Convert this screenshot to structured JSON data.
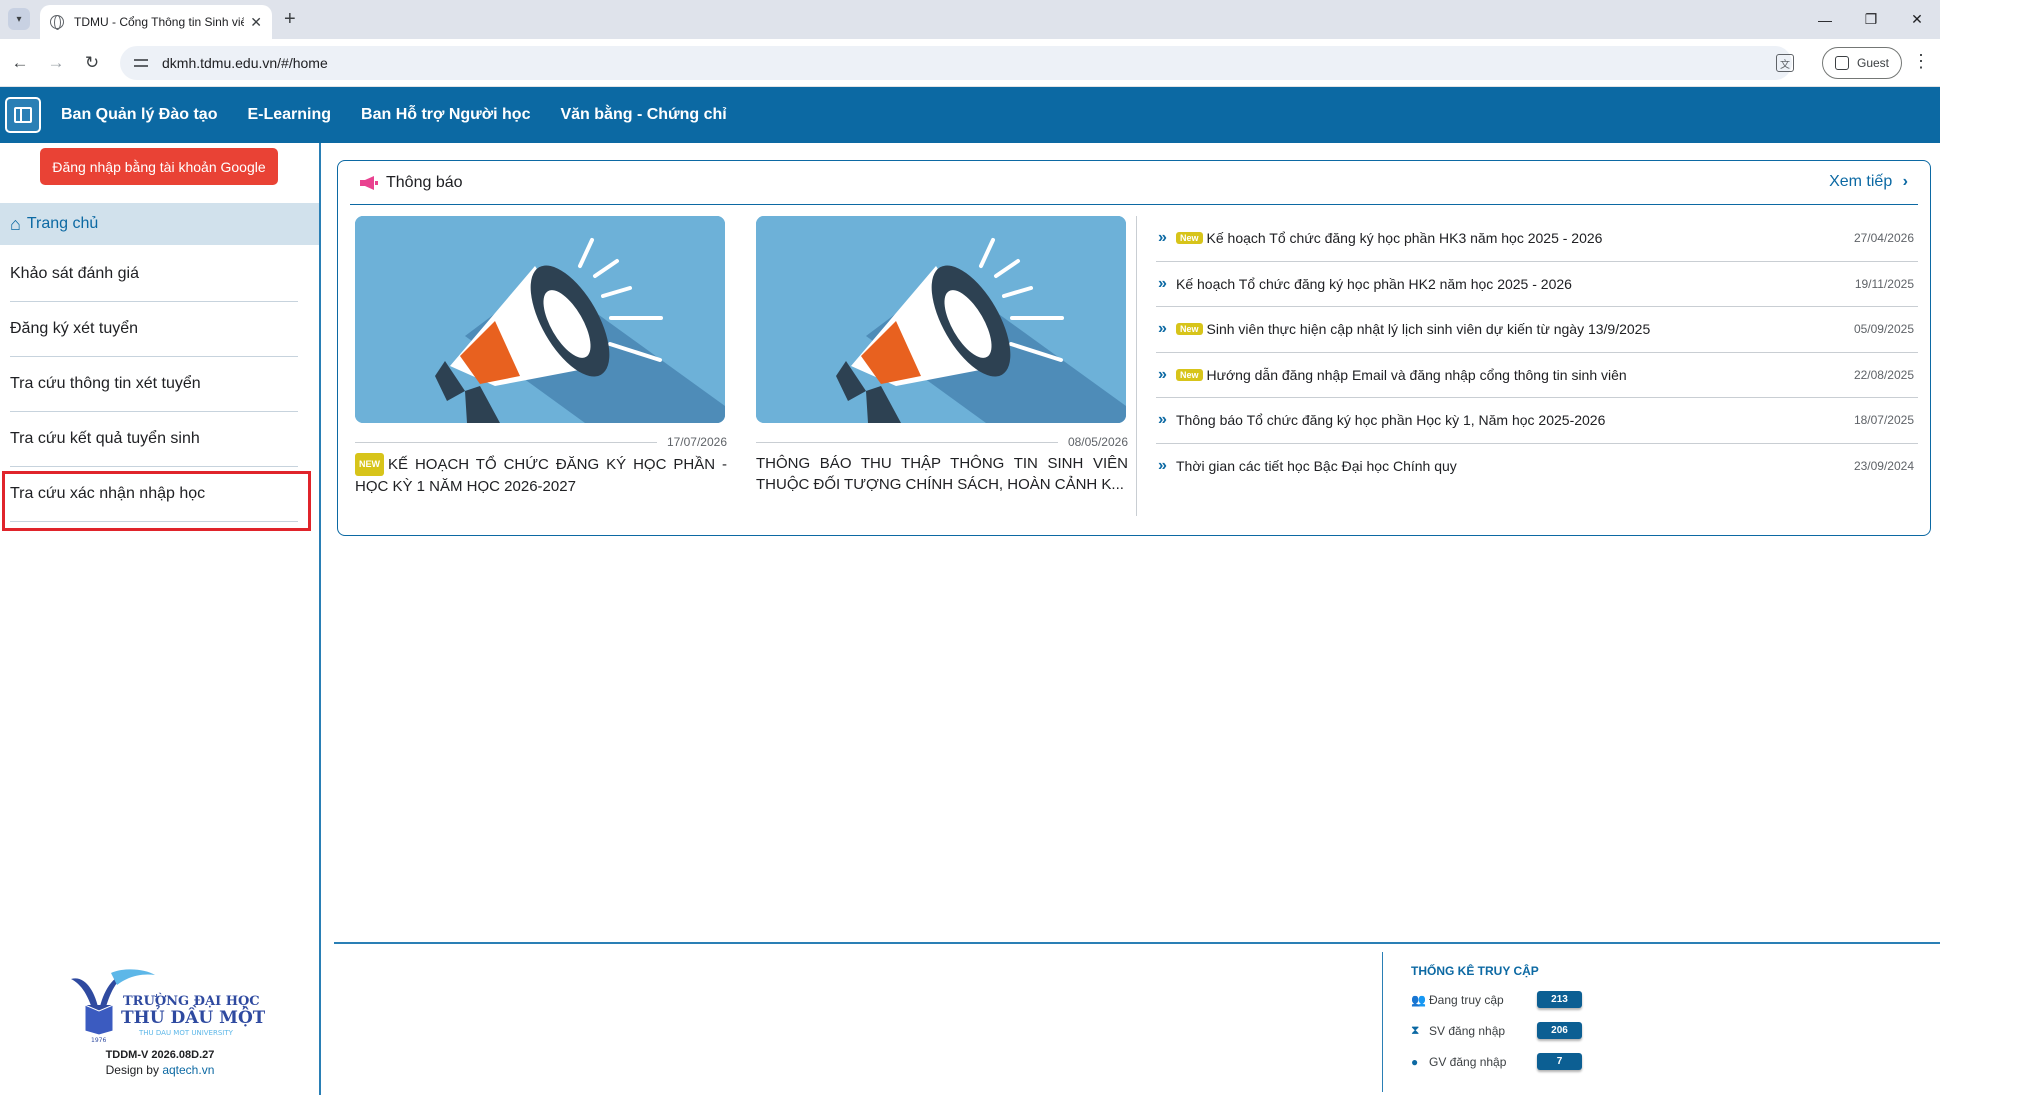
{
  "browser": {
    "tab_title": "TDMU - Cổng Thông tin Sinh viên",
    "url": "dkmh.tdmu.edu.vn/#/home",
    "profile_label": "Guest"
  },
  "header": {
    "nav": [
      "Ban Quản lý Đào tạo",
      "E-Learning",
      "Ban Hỗ trợ Người học",
      "Văn bằng - Chứng chỉ"
    ]
  },
  "sidebar": {
    "google_login": "Đăng nhập bằng tài khoản Google",
    "home": "Trang chủ",
    "items": [
      {
        "label": "Khảo sát đánh giá"
      },
      {
        "label": "Đăng ký xét tuyển"
      },
      {
        "label": "Tra cứu thông tin xét tuyển"
      },
      {
        "label": "Tra cứu kết quả tuyển sinh"
      },
      {
        "label": "Tra cứu xác nhận nhập học"
      }
    ],
    "logo": {
      "line1": "TRƯỜNG ĐẠI HỌC",
      "line2": "THỦ DẦU MỘT",
      "line3": "THU DAU MOT UNIVERSITY",
      "year": "1976"
    },
    "version": "TDDM-V 2026.08D.27",
    "credit_prefix": "Design by",
    "credit_link": "aqtech.vn"
  },
  "announcements": {
    "title": "Thông báo",
    "see_more": "Xem tiếp",
    "new_badge": "New",
    "featured": [
      {
        "date": "17/07/2026",
        "title": "KẾ HOẠCH TỔ CHỨC ĐĂNG KÝ HỌC PHẦN - HỌC KỲ 1 NĂM HỌC 2026-2027",
        "is_new": true
      },
      {
        "date": "08/05/2026",
        "title": "THÔNG BÁO THU THẬP THÔNG TIN SINH VIÊN THUỘC ĐỐI TƯỢNG CHÍNH SÁCH, HOÀN CẢNH K...",
        "is_new": false
      }
    ],
    "list": [
      {
        "text": "Kế hoạch Tổ chức đăng ký học phần HK3 năm học 2025 - 2026",
        "date": "27/04/2026",
        "is_new": true
      },
      {
        "text": "Kế hoạch Tổ chức đăng ký học phần HK2 năm học 2025 - 2026",
        "date": "19/11/2025",
        "is_new": false
      },
      {
        "text": "Sinh viên thực hiện cập nhật lý lịch sinh viên dự kiến từ ngày 13/9/2025",
        "date": "05/09/2025",
        "is_new": true
      },
      {
        "text": "Hướng dẫn đăng nhập Email và đăng nhập cổng thông tin sinh viên",
        "date": "22/08/2025",
        "is_new": true
      },
      {
        "text": "Thông báo Tổ chức đăng ký học phần Học kỳ 1, Năm học 2025-2026",
        "date": "18/07/2025",
        "is_new": false
      },
      {
        "text": "Thời gian các tiết học Bậc Đại học Chính quy",
        "date": "23/09/2024",
        "is_new": false
      }
    ]
  },
  "stats": {
    "title": "THỐNG KÊ TRUY CẬP",
    "rows": [
      {
        "icon": "users-icon",
        "label": "Đang truy cập",
        "value": "213"
      },
      {
        "icon": "student-icon",
        "label": "SV đăng nhập",
        "value": "206"
      },
      {
        "icon": "teacher-icon",
        "label": "GV đăng nhập",
        "value": "7"
      }
    ]
  },
  "colors": {
    "brand": "#0c69a3",
    "google_button": "#e94235",
    "highlight": "#e0242b",
    "new_badge": "#d7c41a"
  }
}
